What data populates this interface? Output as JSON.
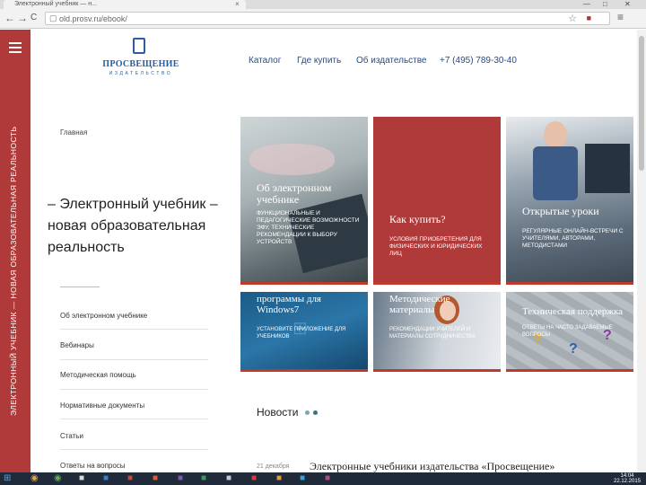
{
  "browser": {
    "tab_title": "Электронный учебник — н...",
    "tab_close": "×",
    "url": "old.prosv.ru/ebook/",
    "nav": {
      "back": "←",
      "forward": "→",
      "reload": "C"
    },
    "window_controls": {
      "min": "—",
      "max": "□",
      "close": "✕"
    }
  },
  "site": {
    "logo_name": "ПРОСВЕЩЕНИЕ",
    "logo_sub": "ИЗДАТЕЛЬСТВО",
    "vertical_tagline": "ЭЛЕКТРОННЫЙ УЧЕБНИК — НОВАЯ ОБРАЗОВАТЕЛЬНАЯ РЕАЛЬНОСТЬ",
    "nav": [
      "Каталог",
      "Где купить",
      "Об издательстве",
      "+7 (495) 789-30-40"
    ],
    "accent_color": "#b03a3a"
  },
  "left": {
    "breadcrumb": "Главная",
    "title": "– Электронный учебник – новая образовательная реальность",
    "menu": [
      "Об электронном учебнике",
      "Вебинары",
      "Методическая помощь",
      "Нормативные документы",
      "Статьи",
      "Ответы на вопросы"
    ]
  },
  "tiles": [
    {
      "title": "Об электронном учебнике",
      "text": "Функциональные и педагогические возможности ЭФУ, технические рекомендации к выбору устройств"
    },
    {
      "title": "Как купить?",
      "text": "Условия приобретения для физических и юридических лиц"
    },
    {
      "title": "Открытые уроки",
      "text": "Регулярные онлайн-встречи с учителями, авторами, методистами"
    },
    {
      "title": "программы для Windows7",
      "text": "Установите приложение для учебников"
    },
    {
      "title": "Методические материалы",
      "text": "Рекомендации учителей и материалы сотрудничества"
    },
    {
      "title": "Техническая поддержка",
      "text": "Ответы на часто задаваемые вопросы"
    }
  ],
  "news": {
    "heading": "Новости",
    "date": "21 декабря",
    "item_title": "Электронные учебники издательства «Просвещение»"
  },
  "taskbar": {
    "time": "14:04",
    "date": "22.12.2015"
  }
}
